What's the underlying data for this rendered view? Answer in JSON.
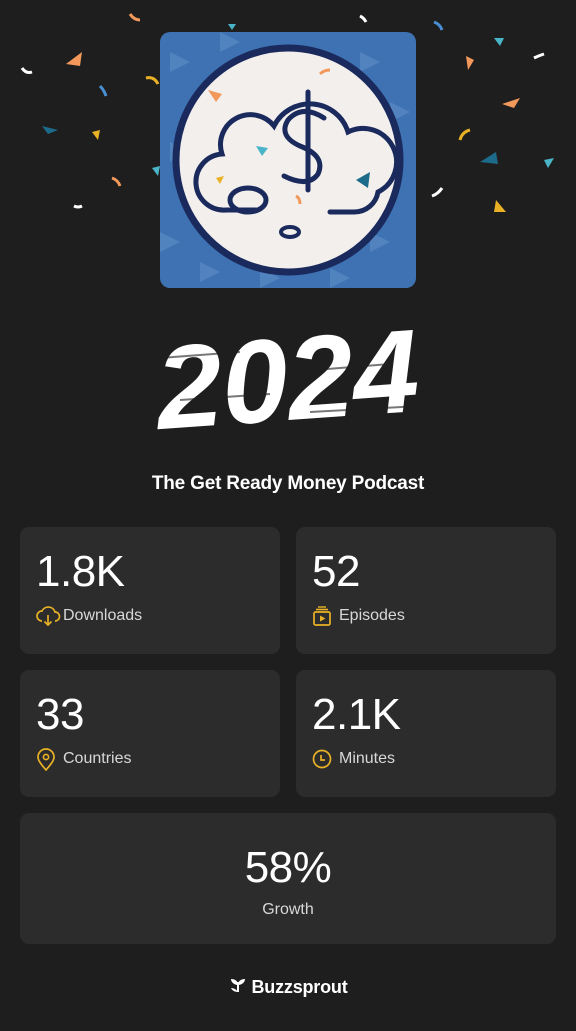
{
  "podcast": {
    "title": "The Get Ready Money Podcast",
    "year": "2024"
  },
  "stats": [
    {
      "value": "1.8K",
      "label": "Downloads",
      "icon": "cloud-download-icon"
    },
    {
      "value": "52",
      "label": "Episodes",
      "icon": "episodes-icon"
    },
    {
      "value": "33",
      "label": "Countries",
      "icon": "location-pin-icon"
    },
    {
      "value": "2.1K",
      "label": "Minutes",
      "icon": "clock-icon"
    }
  ],
  "growth": {
    "value": "58%",
    "label": "Growth"
  },
  "brand": {
    "name": "Buzzsprout",
    "icon": "buzzsprout-logo-icon"
  },
  "colors": {
    "background": "#1e1e1e",
    "card": "#2c2c2c",
    "accent": "#e9b226",
    "cover_blue": "#3f72b3",
    "cover_navy": "#1b2a5c"
  }
}
